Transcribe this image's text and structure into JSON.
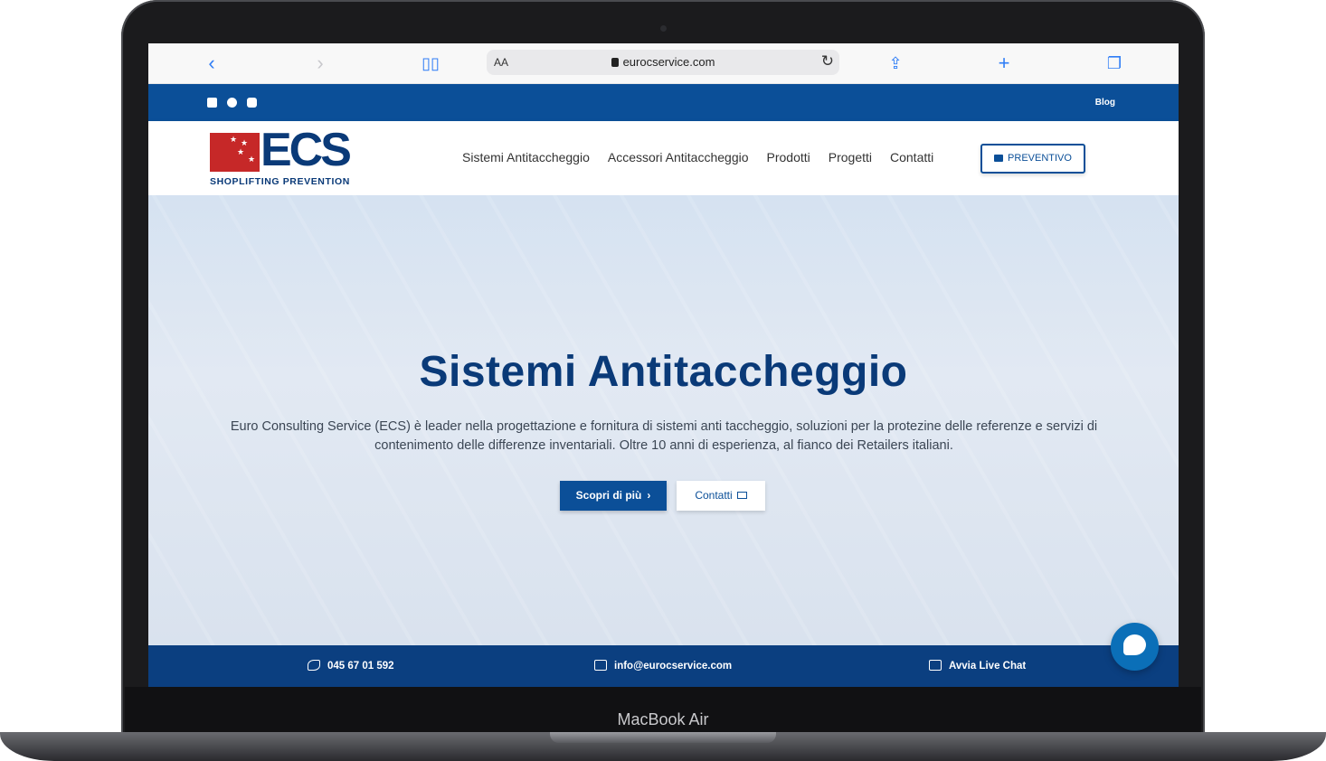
{
  "device": {
    "label": "MacBook Air"
  },
  "browser": {
    "text_size_label": "AA",
    "url": "eurocservice.com"
  },
  "topbar": {
    "social": [
      "linkedin-icon",
      "facebook-icon",
      "instagram-icon"
    ],
    "blog_label": "Blog"
  },
  "header": {
    "logo_text": "ECS",
    "logo_tagline": "SHOPLIFTING PREVENTION",
    "nav": [
      "Sistemi Antitaccheggio",
      "Accessori Antitaccheggio",
      "Prodotti",
      "Progetti",
      "Contatti"
    ],
    "quote_button": "PREVENTIVO"
  },
  "hero": {
    "title": "Sistemi Antitaccheggio",
    "text": "Euro Consulting Service (ECS) è leader nella progettazione e fornitura di sistemi anti taccheggio, soluzioni per la protezine delle referenze e servizi di contenimento delle differenze inventariali. Oltre 10 anni di esperienza, al fianco dei Retailers italiani.",
    "primary_button": "Scopri di più",
    "secondary_button": "Contatti"
  },
  "contact_bar": {
    "phone": "045 67 01 592",
    "email": "info@eurocservice.com",
    "chat": "Avvia Live Chat"
  },
  "colors": {
    "brand_blue": "#0b4f98",
    "dark_blue": "#0a3a78",
    "logo_red": "#c62828"
  }
}
